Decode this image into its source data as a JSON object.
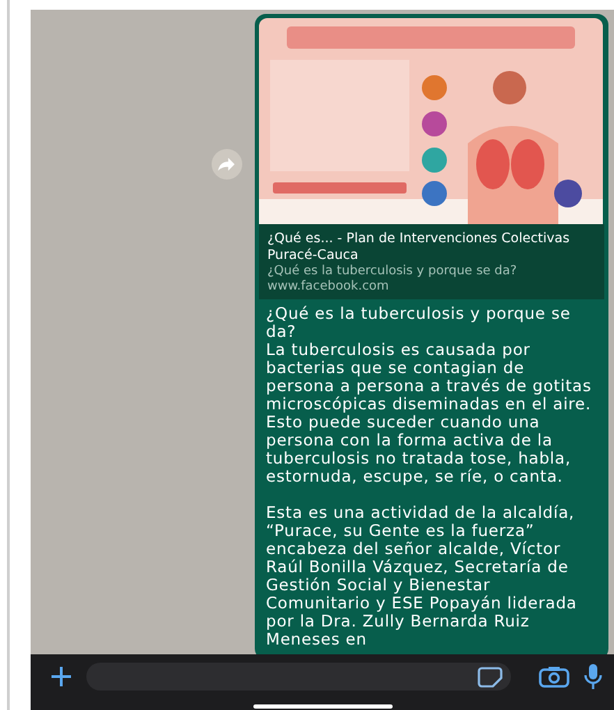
{
  "message": {
    "link_preview": {
      "title": "¿Qué es... - Plan de Intervenciones Colectivas Puracé-Cauca",
      "description": "¿Qué es la tuberculosis y porque se da?",
      "domain": "www.facebook.com"
    },
    "paragraphs": [
      "¿Qué es la tuberculosis y porque se da?\nLa tuberculosis es causada por bacterias que se contagian de persona a persona a través de gotitas microscópicas diseminadas en el aire. Esto puede suceder cuando una persona con la forma activa de la tuberculosis no tratada tose, habla, estornuda, escupe, se ríe, o canta.",
      "Esta es una actividad de la alcaldía, “Purace, su Gente es la fuerza” encabeza del señor alcalde, Víctor Raúl Bonilla Vázquez, Secretaría de Gestión Social y Bienestar Comunitario y ESE Popayán liderada por la Dra. Zully Bernarda Ruiz Meneses en"
    ]
  }
}
